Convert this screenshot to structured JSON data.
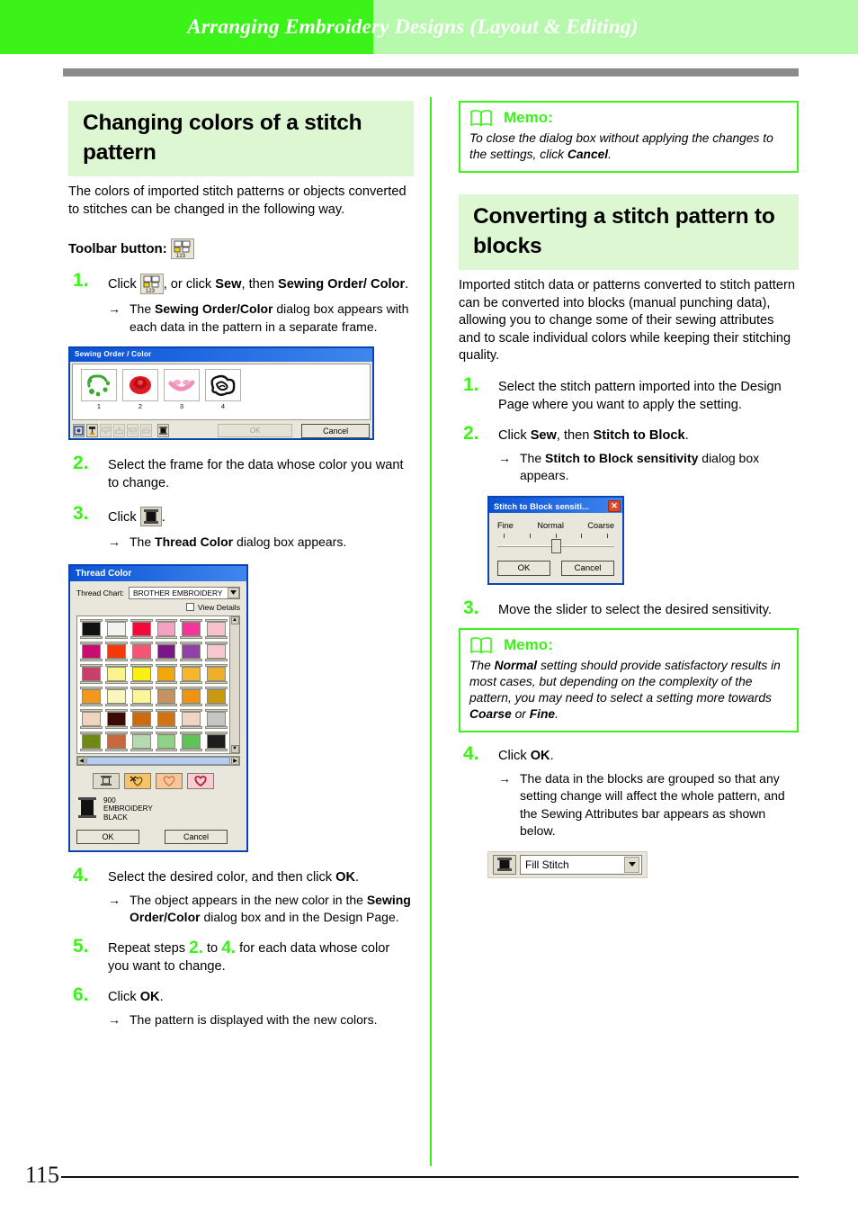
{
  "header": {
    "title": "Arranging Embroidery Designs (Layout & Editing)",
    "accent_bright": "#3bf318",
    "accent_light": "#b6f9ac",
    "rule_color": "#8b8b8b"
  },
  "footer": {
    "page_number": "115"
  },
  "left_column": {
    "section_title": "Changing colors of a stitch pattern",
    "intro": "The colors of imported stitch patterns or objects converted to stitches can be changed in the following way.",
    "toolbar_label": "Toolbar button:",
    "toolbar_icon": "sewing-order-123-icon",
    "steps": [
      {
        "num": "1.",
        "text_a": "Click ",
        "icon": "sewing-order-123-icon",
        "text_b": ", or click ",
        "bold_b": "Sew",
        "text_c": ", then ",
        "bold_c": "Sewing Order/ Color",
        "text_d": ".",
        "note_arrow": "→",
        "note_a": "The ",
        "note_bold": "Sewing Order/Color",
        "note_b": " dialog box appears with each data in the pattern in a separate frame."
      },
      {
        "num": "2.",
        "text": "Select the frame for the data whose color you want to change."
      },
      {
        "num": "3.",
        "text_a": "Click ",
        "icon": "thread-spool-icon",
        "text_b": ".",
        "note_arrow": "→",
        "note_a": "The ",
        "note_bold": "Thread Color",
        "note_b": " dialog box appears."
      },
      {
        "num": "4.",
        "text_a": "Select the desired color, and then click ",
        "bold": "OK",
        "text_b": ".",
        "note_arrow": "→",
        "note_a": "The object appears in the new color in the ",
        "note_bold": "Sewing Order/Color",
        "note_b": " dialog box and in the Design Page."
      },
      {
        "num": "5.",
        "text_a": "Repeat steps ",
        "ref1": "2.",
        "text_b": " to ",
        "ref2": "4.",
        "text_c": " for each data whose color you want to change."
      },
      {
        "num": "6.",
        "text_a": "Click ",
        "bold": "OK",
        "text_b": ".",
        "note_arrow": "→",
        "note_a": "The pattern is displayed with the new colors."
      }
    ],
    "sewing_order_dialog": {
      "title": "Sewing Order / Color",
      "items": [
        {
          "label": "1",
          "color": "#3ea832",
          "shape": "wreath"
        },
        {
          "label": "2",
          "color": "#e01a22",
          "shape": "rose"
        },
        {
          "label": "3",
          "color": "#f08fb8",
          "shape": "petal"
        },
        {
          "label": "4",
          "color": "#111111",
          "shape": "scribble"
        }
      ],
      "ok_label": "OK",
      "cancel_label": "Cancel",
      "toolbar_icons": [
        "zoom-icon",
        "sort-icon",
        "move-up-icon",
        "move-down-icon",
        "move-first-icon",
        "move-last-icon",
        "thread-spool-icon"
      ]
    },
    "thread_color_dialog": {
      "title": "Thread Color",
      "chart_label": "Thread Chart:",
      "chart_value": "BROTHER EMBROIDERY",
      "view_details_label": "View Details",
      "view_details_checked": false,
      "selected_code": "900",
      "selected_name_line1": "EMBROIDERY",
      "selected_name_line2": "BLACK",
      "selected_color": "#111111",
      "ok_label": "OK",
      "cancel_label": "Cancel",
      "swatch_colors": [
        "#111111",
        "#f2f2ef",
        "#f20a3c",
        "#f6a0c2",
        "#f5339d",
        "#f9c2cb",
        "#c90c72",
        "#f53a0a",
        "#f45577",
        "#7c1585",
        "#9040a8",
        "#f7c9cf",
        "#c74069",
        "#faf58a",
        "#faf014",
        "#f2a80c",
        "#f5b52c",
        "#efae2b",
        "#f2981c",
        "#faf6bd",
        "#faf79a",
        "#c79261",
        "#f29213",
        "#c9990e",
        "#efd4c0",
        "#3a0a06",
        "#cc6a12",
        "#d4720f",
        "#f0d4c4",
        "#c6c6c6",
        "#6f8a14",
        "#c7683c",
        "#b6d9b0",
        "#8fd186",
        "#5ec457",
        "#1d1d1d"
      ],
      "action_buttons": [
        "thread-spool-icon",
        "favorite-add-icon",
        "favorite-outline-icon",
        "favorite-filled-icon"
      ]
    }
  },
  "right_column": {
    "memo_top": {
      "icon": "book-icon",
      "title": "Memo:",
      "text_a": "To close the dialog box without applying the changes to the settings, click ",
      "bold": "Cancel",
      "text_b": "."
    },
    "section_title": "Converting a stitch pattern to blocks",
    "intro": "Imported stitch data or patterns converted to stitch pattern can be converted into blocks (manual punching data), allowing you to change some of their sewing attributes and to scale individual colors while keeping their stitching quality.",
    "steps": [
      {
        "num": "1.",
        "text": "Select the stitch pattern imported into the Design Page where you want to apply the setting."
      },
      {
        "num": "2.",
        "text_a": "Click ",
        "bold_a": "Sew",
        "text_b": ", then ",
        "bold_b": "Stitch to Block",
        "text_c": ".",
        "note_arrow": "→",
        "note_a": "The ",
        "note_bold": "Stitch to Block sensitivity",
        "note_b": " dialog box appears."
      },
      {
        "num": "3.",
        "text": "Move the slider to select the desired sensitivity."
      },
      {
        "num": "4.",
        "text_a": "Click ",
        "bold": "OK",
        "text_b": ".",
        "note_arrow": "→",
        "note_a": "The data in the blocks are grouped so that any setting change will affect the whole pattern, and the Sewing Attributes bar appears as shown below."
      }
    ],
    "memo_bottom": {
      "icon": "book-icon",
      "title": "Memo:",
      "text_a": "The ",
      "bold_a": "Normal",
      "text_b": " setting should provide satisfactory results in most cases, but depending on the complexity of the pattern, you may need to select a setting more towards ",
      "bold_b": "Coarse",
      "text_c": " or ",
      "bold_c": "Fine",
      "text_d": "."
    },
    "stitch_to_block_dialog": {
      "title": "Stitch to Block sensiti...",
      "close_label": "✕",
      "label_fine": "Fine",
      "label_normal": "Normal",
      "label_coarse": "Coarse",
      "tick_count": 5,
      "slider_position": "Normal",
      "ok_label": "OK",
      "cancel_label": "Cancel"
    },
    "attributes_bar": {
      "spool_icon": "thread-spool-icon",
      "stitch_type": "Fill Stitch",
      "dropdown_icon": "chevron-down-icon"
    }
  }
}
